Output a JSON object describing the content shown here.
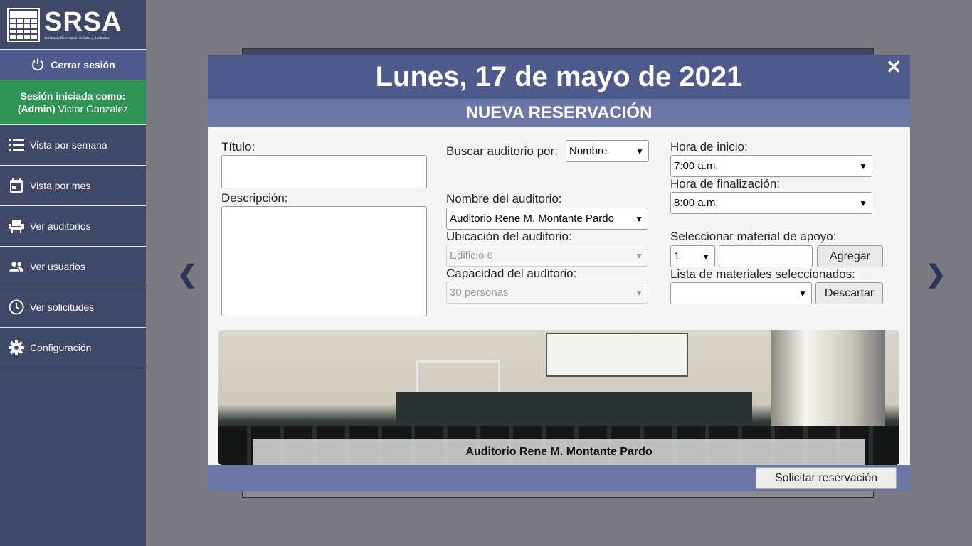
{
  "sidebar": {
    "logo_title": "SRSA",
    "logo_subtitle": "Sistema de Reservación de Salas y Auditorios",
    "logout_label": "Cerrar sesión",
    "session_heading": "Sesión iniciada como:",
    "session_role": "(Admin)",
    "session_user": "Victor Gonzalez",
    "items": [
      {
        "label": "Vista por semana",
        "icon": "list-icon"
      },
      {
        "label": "Vista por mes",
        "icon": "calendar-icon"
      },
      {
        "label": "Ver auditorios",
        "icon": "seat-icon"
      },
      {
        "label": "Ver usuarios",
        "icon": "users-icon"
      },
      {
        "label": "Ver solicitudes",
        "icon": "clock-icon"
      },
      {
        "label": "Configuración",
        "icon": "gear-icon"
      }
    ]
  },
  "modal": {
    "date_title": "Lunes, 17 de mayo de 2021",
    "subtitle": "NUEVA RESERVACIÓN",
    "close_symbol": "✕",
    "form": {
      "title_label": "Título:",
      "title_value": "",
      "description_label": "Descripción:",
      "description_value": "",
      "search_by_label": "Buscar auditorio por:",
      "search_by_value": "Nombre",
      "auditorium_name_label": "Nombre del auditorio:",
      "auditorium_name_value": "Auditorio Rene M. Montante Pardo",
      "location_label": "Ubicación del auditorio:",
      "location_value": "Edificio 6",
      "capacity_label": "Capacidad del auditorio:",
      "capacity_value": "30 personas",
      "start_label": "Hora de inicio:",
      "start_value": "7:00 a.m.",
      "end_label": "Hora de finalización:",
      "end_value": "8:00 a.m.",
      "material_label": "Seleccionar material de apoyo:",
      "material_qty": "1",
      "material_value": "",
      "add_label": "Agregar",
      "selected_list_label": "Lista de materiales seleccionados:",
      "selected_list_value": "",
      "discard_label": "Descartar"
    },
    "photo_caption": "Auditorio Rene M. Montante Pardo",
    "submit_label": "Solicitar reservación"
  },
  "nav": {
    "prev": "❮",
    "next": "❯"
  }
}
